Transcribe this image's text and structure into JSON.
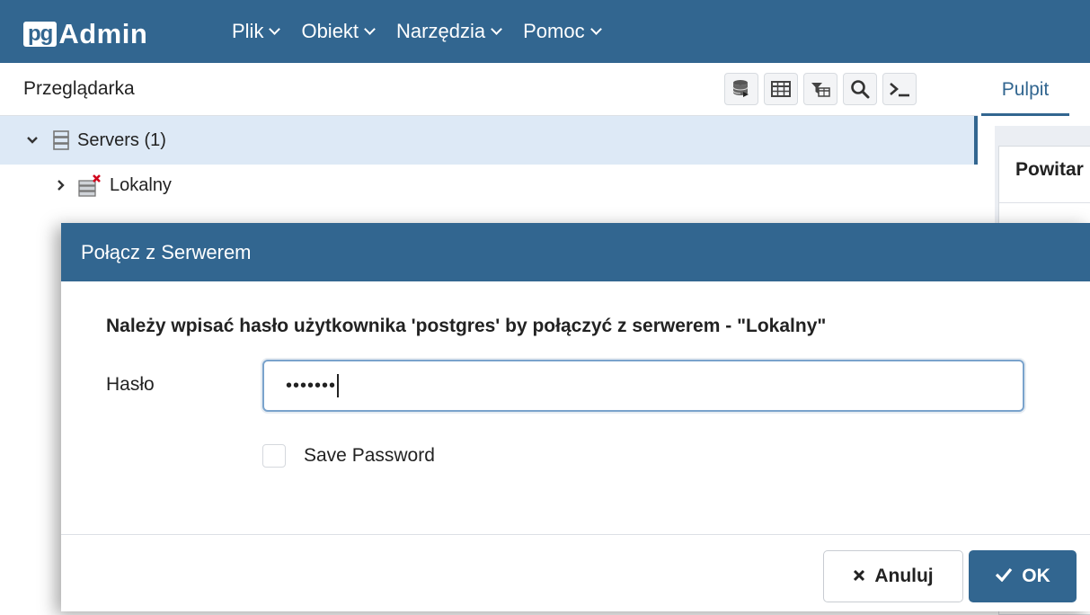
{
  "colors": {
    "brand": "#326690",
    "selected_row": "#dde9f6"
  },
  "navbar": {
    "logo_pg": "pg",
    "logo_admin": "Admin",
    "menu": [
      {
        "label": "Plik",
        "icon": "chevron-down-icon"
      },
      {
        "label": "Obiekt",
        "icon": "chevron-down-icon"
      },
      {
        "label": "Narzędzia",
        "icon": "chevron-down-icon"
      },
      {
        "label": "Pomoc",
        "icon": "chevron-down-icon"
      }
    ]
  },
  "browser": {
    "title": "Przeglądarka",
    "toolbar": [
      "database-query-icon",
      "table-grid-icon",
      "filter-table-icon",
      "search-icon",
      "terminal-icon"
    ],
    "tree": [
      {
        "label": "Servers (1)",
        "icon": "server-group-icon",
        "expanded": true,
        "selected": true
      },
      {
        "label": "Lokalny",
        "icon": "server-disconnected-icon",
        "expanded": false,
        "selected": false
      }
    ]
  },
  "tabs": {
    "active": "Pulpit"
  },
  "dashboard": {
    "panel_title": "Powitar"
  },
  "dialog": {
    "title": "Połącz z Serwerem",
    "message": "Należy wpisać hasło użytkownika 'postgres' by połączyć z serwerem - \"Lokalny\"",
    "password_label": "Hasło",
    "password_value": "•••••••",
    "save_password_label": "Save Password",
    "save_password_checked": false,
    "cancel_label": "Anuluj",
    "cancel_icon": "close-icon",
    "ok_label": "OK",
    "ok_icon": "check-icon"
  }
}
